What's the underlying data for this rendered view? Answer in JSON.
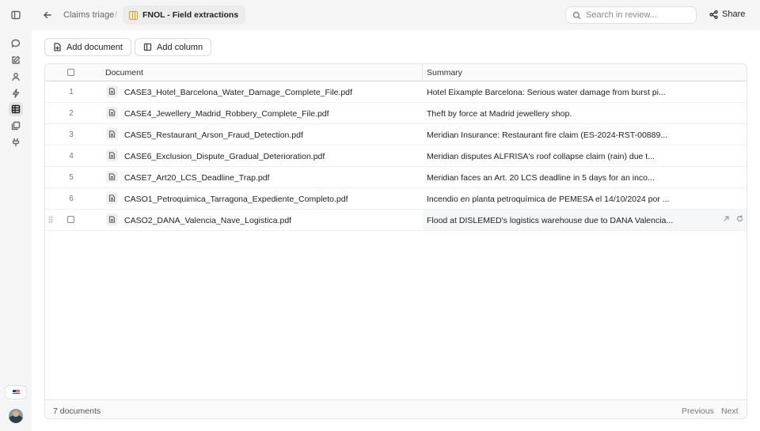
{
  "rail": {
    "items": [
      {
        "name": "sidebar-toggle-icon"
      },
      {
        "name": "chat-icon"
      },
      {
        "name": "edit-icon"
      },
      {
        "name": "user-icon"
      },
      {
        "name": "workflow-icon"
      },
      {
        "name": "table-icon",
        "active": true
      },
      {
        "name": "library-icon"
      },
      {
        "name": "plugin-icon"
      }
    ]
  },
  "header": {
    "breadcrumb_parent": "Claims triage",
    "breadcrumb_separator": "/",
    "breadcrumb_current": "FNOL - Field extractions",
    "search_placeholder": "Search in review...",
    "share_label": "Share"
  },
  "toolbar": {
    "add_document_label": "Add document",
    "add_column_label": "Add column"
  },
  "table": {
    "columns": [
      "Document",
      "Summary"
    ],
    "rows": [
      {
        "num": "1",
        "document": "CASE3_Hotel_Barcelona_Water_Damage_Complete_File.pdf",
        "summary": "Hotel Eixample Barcelona: Serious water damage from burst pi..."
      },
      {
        "num": "2",
        "document": "CASE4_Jewellery_Madrid_Robbery_Complete_File.pdf",
        "summary": "Theft by force at Madrid jewellery shop."
      },
      {
        "num": "3",
        "document": "CASE5_Restaurant_Arson_Fraud_Detection.pdf",
        "summary": "Meridian Insurance: Restaurant fire claim (ES-2024-RST-00889..."
      },
      {
        "num": "4",
        "document": "CASE6_Exclusion_Dispute_Gradual_Deterioration.pdf",
        "summary": "Meridian disputes ALFRISA's roof collapse claim (rain) due t..."
      },
      {
        "num": "5",
        "document": "CASE7_Art20_LCS_Deadline_Trap.pdf",
        "summary": "Meridian faces an Art. 20 LCS deadline in 5 days for an inco..."
      },
      {
        "num": "6",
        "document": "CASO1_Petroquimica_Tarragona_Expediente_Completo.pdf",
        "summary": "Incendio en planta petroquímica de PEMESA el 14/10/2024 por ..."
      },
      {
        "num": "",
        "document": "CASO2_DANA_Valencia_Nave_Logistica.pdf",
        "summary": "Flood at DISLEMED's logistics warehouse due to DANA Valencia...",
        "hovered": true
      }
    ]
  },
  "footer": {
    "count_label": "7 documents",
    "previous_label": "Previous",
    "next_label": "Next"
  },
  "colors": {
    "accent": "#e0a300",
    "background": "#f5f5f5",
    "surface": "#ffffff"
  }
}
